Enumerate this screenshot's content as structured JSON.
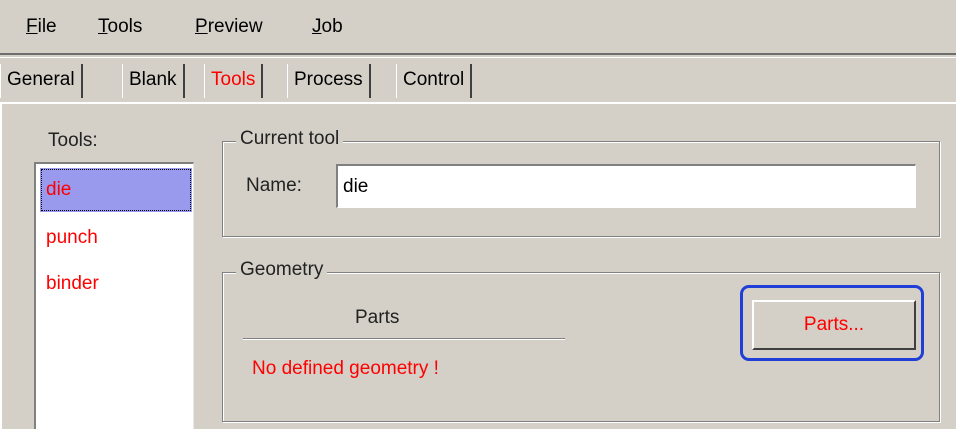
{
  "menu": {
    "items": [
      {
        "label_pre": "",
        "label_ul": "F",
        "label_post": "ile"
      },
      {
        "label_pre": "",
        "label_ul": "T",
        "label_post": "ools"
      },
      {
        "label_pre": "",
        "label_ul": "P",
        "label_post": "review"
      },
      {
        "label_pre": "",
        "label_ul": "J",
        "label_post": "ob"
      }
    ]
  },
  "tabs": [
    {
      "label": "General"
    },
    {
      "label": "Blank"
    },
    {
      "label": "Tools"
    },
    {
      "label": "Process"
    },
    {
      "label": "Control"
    }
  ],
  "active_tab": "Tools",
  "tools_panel": {
    "label": "Tools:",
    "items": [
      "die",
      "punch",
      "binder"
    ],
    "selected": "die"
  },
  "current_tool": {
    "title": "Current tool",
    "name_label": "Name:",
    "name_value": "die"
  },
  "geometry": {
    "title": "Geometry",
    "parts_header": "Parts",
    "status": "No defined geometry !",
    "parts_button_label": "Parts..."
  },
  "colors": {
    "window_bg": "#d4d0c8",
    "accent_red": "#ff0000",
    "selection": "#9999ee",
    "highlight_box": "#1f3fd6"
  }
}
